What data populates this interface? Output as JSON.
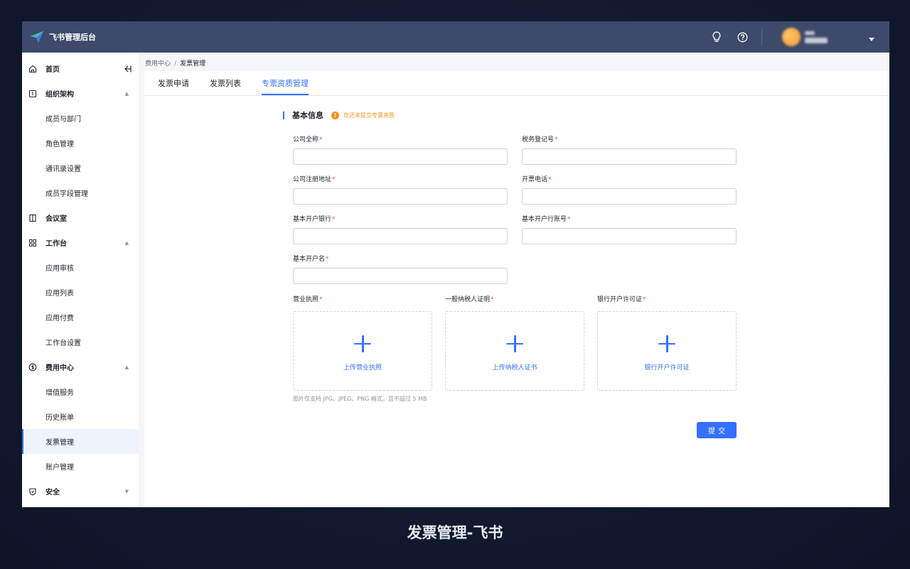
{
  "app": {
    "title": "飞书管理后台"
  },
  "header": {
    "icons": [
      "bulb-icon",
      "help-icon",
      "user-avatar",
      "chevron-down-icon"
    ]
  },
  "sidebar": {
    "items": [
      {
        "label": "首页",
        "icon": "home-icon",
        "type": "group"
      },
      {
        "label": "组织架构",
        "icon": "org-icon",
        "type": "group",
        "expanded": true
      },
      {
        "label": "成员与部门",
        "type": "child"
      },
      {
        "label": "角色管理",
        "type": "child"
      },
      {
        "label": "通讯录设置",
        "type": "child"
      },
      {
        "label": "成员字段管理",
        "type": "child"
      },
      {
        "label": "会议室",
        "icon": "door-icon",
        "type": "group"
      },
      {
        "label": "工作台",
        "icon": "grid-icon",
        "type": "group",
        "expanded": true
      },
      {
        "label": "应用审核",
        "type": "child"
      },
      {
        "label": "应用列表",
        "type": "child"
      },
      {
        "label": "应用付费",
        "type": "child"
      },
      {
        "label": "工作台设置",
        "type": "child"
      },
      {
        "label": "费用中心",
        "icon": "coin-icon",
        "type": "group",
        "expanded": true
      },
      {
        "label": "增值服务",
        "type": "child"
      },
      {
        "label": "历史账单",
        "type": "child"
      },
      {
        "label": "发票管理",
        "type": "child",
        "active": true
      },
      {
        "label": "账户管理",
        "type": "child"
      },
      {
        "label": "安全",
        "icon": "shield-icon",
        "type": "group",
        "expanded": false
      }
    ]
  },
  "breadcrumb": {
    "parent": "费用中心",
    "separator": "/",
    "current": "发票管理"
  },
  "tabs": [
    {
      "label": "发票申请"
    },
    {
      "label": "发票列表"
    },
    {
      "label": "专票资质管理",
      "active": true
    }
  ],
  "form": {
    "section_title": "基本信息",
    "warning": "您还未提交专票资质",
    "required_mark": "*",
    "fields": {
      "company_name": {
        "label": "公司全称",
        "value": ""
      },
      "tax_number": {
        "label": "税务登记号",
        "value": ""
      },
      "company_address": {
        "label": "公司注册地址",
        "value": ""
      },
      "invoice_phone": {
        "label": "开票电话",
        "value": ""
      },
      "bank_name": {
        "label": "基本开户银行",
        "value": ""
      },
      "bank_account": {
        "label": "基本开户行账号",
        "value": ""
      },
      "account_name": {
        "label": "基本开户名",
        "value": ""
      }
    },
    "uploads": [
      {
        "label": "营业执照",
        "button": "上传营业执照"
      },
      {
        "label": "一般纳税人证明",
        "button": "上传纳税人证书"
      },
      {
        "label": "银行开户许可证",
        "button": "银行开户许可证"
      }
    ],
    "hint": "图片仅支持 JPG、JPEG、PNG 格式，且不超过 5 MB",
    "submit_label": "提交"
  },
  "caption": "发票管理-飞书",
  "colors": {
    "topbar": "#3d4a6b",
    "accent": "#3370ff",
    "warning": "#f5911e",
    "required": "#f54a45"
  }
}
